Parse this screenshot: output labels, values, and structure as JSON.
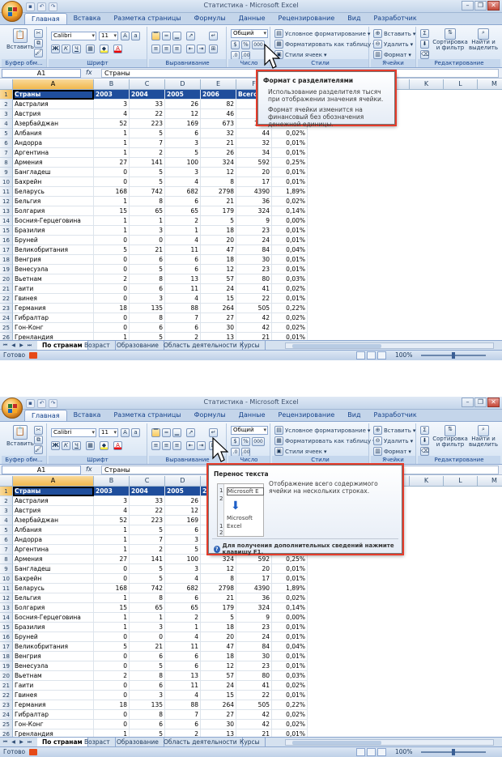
{
  "app": {
    "title": "Статистика - Microsoft Excel",
    "tabs": [
      "Главная",
      "Вставка",
      "Разметка страницы",
      "Формулы",
      "Данные",
      "Рецензирование",
      "Вид",
      "Разработчик"
    ],
    "active_tab": "Главная",
    "window_buttons": {
      "minimize": "–",
      "restore": "❐",
      "close": "✕"
    }
  },
  "ribbon": {
    "paste_label": "Вставить",
    "font_name": "Calibri",
    "font_size": "11",
    "number_format": "Общий",
    "percent": "%",
    "thousands": "000",
    "styles": {
      "conditional": "Условное форматирование",
      "as_table": "Форматировать как таблицу",
      "cell_styles": "Стили ячеек"
    },
    "cells": {
      "insert": "Вставить",
      "delete": "Удалить",
      "format": "Формат"
    },
    "editing": {
      "sum": "Σ",
      "sort": "Сортировка и фильтр",
      "find": "Найти и выделить"
    },
    "group_labels": {
      "clipboard": "Буфер обм...",
      "font": "Шрифт",
      "alignment": "Выравнивание",
      "number": "Число",
      "styles": "Стили",
      "cells": "Ячейки",
      "editing": "Редактирование"
    }
  },
  "formula_bar": {
    "name_box": "A1",
    "fx": "fx",
    "value": "Страны"
  },
  "grid": {
    "columns": [
      "A",
      "B",
      "C",
      "D",
      "E",
      "F",
      "G",
      "H",
      "I",
      "J",
      "K",
      "L",
      "M"
    ],
    "header_row": [
      "Страны",
      "2003",
      "2004",
      "2005",
      "2006",
      "Всего"
    ],
    "rows": [
      [
        "Австралия",
        "3",
        "33",
        "26",
        "82",
        "",
        ""
      ],
      [
        "Австрия",
        "4",
        "22",
        "12",
        "46",
        "",
        ""
      ],
      [
        "Азербайджан",
        "52",
        "223",
        "169",
        "673",
        "1117",
        "0,48%"
      ],
      [
        "Албания",
        "1",
        "5",
        "6",
        "32",
        "44",
        "0,02%"
      ],
      [
        "Андорра",
        "1",
        "7",
        "3",
        "21",
        "32",
        "0,01%"
      ],
      [
        "Аргентина",
        "1",
        "2",
        "5",
        "26",
        "34",
        "0,01%"
      ],
      [
        "Армения",
        "27",
        "141",
        "100",
        "324",
        "592",
        "0,25%"
      ],
      [
        "Бангладеш",
        "0",
        "5",
        "3",
        "12",
        "20",
        "0,01%"
      ],
      [
        "Бахрейн",
        "0",
        "5",
        "4",
        "8",
        "17",
        "0,01%"
      ],
      [
        "Беларусь",
        "168",
        "742",
        "682",
        "2798",
        "4390",
        "1,89%"
      ],
      [
        "Бельгия",
        "1",
        "8",
        "6",
        "21",
        "36",
        "0,02%"
      ],
      [
        "Болгария",
        "15",
        "65",
        "65",
        "179",
        "324",
        "0,14%"
      ],
      [
        "Босния-Герцеговина",
        "1",
        "1",
        "2",
        "5",
        "9",
        "0,00%"
      ],
      [
        "Бразилия",
        "1",
        "3",
        "1",
        "18",
        "23",
        "0,01%"
      ],
      [
        "Бруней",
        "0",
        "0",
        "4",
        "20",
        "24",
        "0,01%"
      ],
      [
        "Великобритания",
        "5",
        "21",
        "11",
        "47",
        "84",
        "0,04%"
      ],
      [
        "Венгрия",
        "0",
        "6",
        "6",
        "18",
        "30",
        "0,01%"
      ],
      [
        "Венесуэла",
        "0",
        "5",
        "6",
        "12",
        "23",
        "0,01%"
      ],
      [
        "Вьетнам",
        "2",
        "8",
        "13",
        "57",
        "80",
        "0,03%"
      ],
      [
        "Гаити",
        "0",
        "6",
        "11",
        "24",
        "41",
        "0,02%"
      ],
      [
        "Гвинея",
        "0",
        "3",
        "4",
        "15",
        "22",
        "0,01%"
      ],
      [
        "Германия",
        "18",
        "135",
        "88",
        "264",
        "505",
        "0,22%"
      ],
      [
        "Гибралтар",
        "0",
        "8",
        "7",
        "27",
        "42",
        "0,02%"
      ],
      [
        "Гон-Конг",
        "0",
        "6",
        "6",
        "30",
        "42",
        "0,02%"
      ],
      [
        "Гренландия",
        "1",
        "5",
        "2",
        "13",
        "21",
        "0,01%"
      ]
    ]
  },
  "sheet_tabs": [
    "По странам",
    "Возраст",
    "Образование",
    "Область деятельности",
    "Курсы"
  ],
  "status": {
    "ready": "Готово",
    "zoom": "100%"
  },
  "tooltip1": {
    "title": "Формат с разделителями",
    "line1": "Использование разделителя тысяч при отображении значения ячейки.",
    "line2": "Формат ячейки изменится на финансовый без обозначения денежной единицы."
  },
  "tooltip2": {
    "title": "Перенос текста",
    "description": "Отображение всего содержимого ячейки на нескольких строках.",
    "example_before": "Microsoft E",
    "example_after_1": "Microsoft",
    "example_after_2": "Excel",
    "help": "Для получения дополнительных сведений нажмите клавишу F1."
  }
}
